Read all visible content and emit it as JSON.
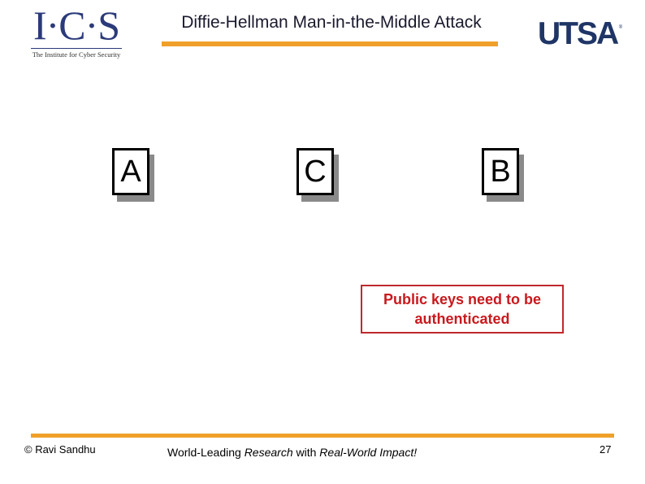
{
  "header": {
    "title": "Diffie-Hellman Man-in-the-Middle Attack",
    "left_logo": {
      "main": "I·C·S",
      "subtitle": "The Institute for Cyber Security"
    },
    "right_logo": {
      "main": "UTSA",
      "mark": "®"
    }
  },
  "diagram": {
    "parties": [
      {
        "label": "A"
      },
      {
        "label": "C"
      },
      {
        "label": "B"
      }
    ],
    "note": {
      "line1": "Public keys need to be",
      "line2": "authenticated",
      "color": "#c8191e"
    }
  },
  "footer": {
    "copyright": "© Ravi  Sandhu",
    "tagline_part1": "World-Leading ",
    "tagline_part2": "Research",
    "tagline_part3": " with ",
    "tagline_part4": "Real-World Impact!",
    "page_number": "27"
  },
  "colors": {
    "accent": "#f0a02a",
    "brand_navy": "#1f3566",
    "alert_red": "#c8191e"
  }
}
